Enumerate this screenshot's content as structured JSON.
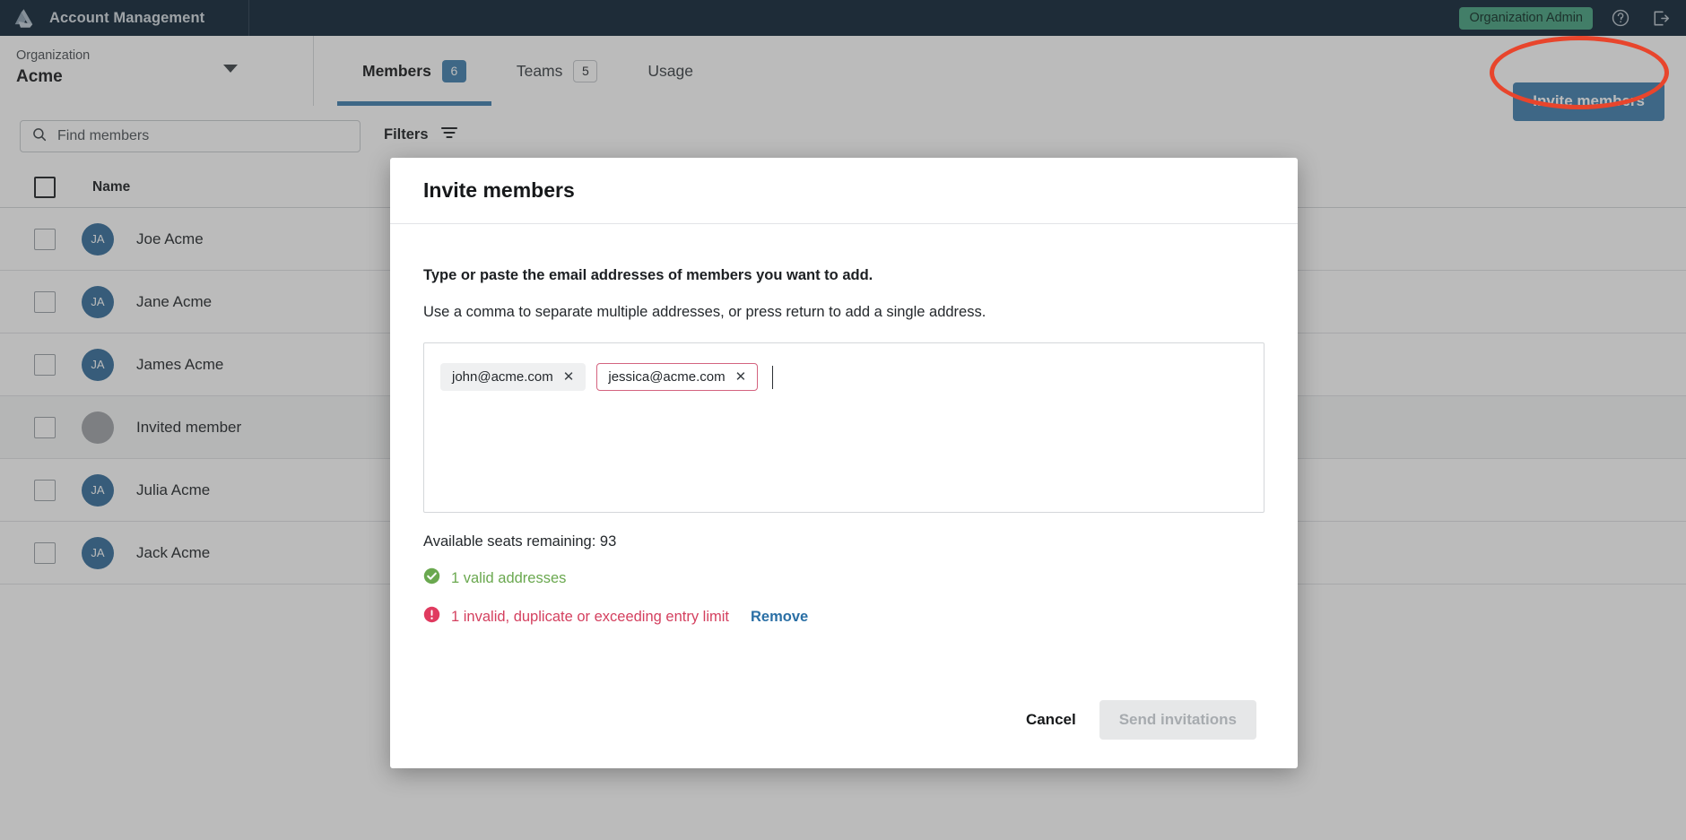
{
  "topbar": {
    "logo_icon": "drive-triangle-logo",
    "title": "Account Management",
    "role_badge": "Organization Admin",
    "help_icon": "help-circle-icon",
    "logout_icon": "logout-icon"
  },
  "subheader": {
    "org_label": "Organization",
    "org_name": "Acme",
    "caret_icon": "chevron-down-icon",
    "tabs": [
      {
        "label": "Members",
        "badge": "6",
        "active": true
      },
      {
        "label": "Teams",
        "badge": "5",
        "active": false
      },
      {
        "label": "Usage",
        "badge": "",
        "active": false
      }
    ],
    "invite_button": "Invite members"
  },
  "toolbar": {
    "search_icon": "search-icon",
    "search_placeholder": "Find members",
    "search_value": "",
    "filters_label": "Filters",
    "filters_icon": "filter-icon"
  },
  "table": {
    "select_all_checkbox": "",
    "columns": [
      "Name"
    ],
    "rows": [
      {
        "initials": "JA",
        "name": "Joe Acme",
        "invited": false
      },
      {
        "initials": "JA",
        "name": "Jane Acme",
        "invited": false
      },
      {
        "initials": "JA",
        "name": "James Acme",
        "invited": false
      },
      {
        "initials": "",
        "name": "Invited member",
        "invited": true
      },
      {
        "initials": "JA",
        "name": "Julia Acme",
        "invited": false
      },
      {
        "initials": "JA",
        "name": "Jack Acme",
        "invited": false
      }
    ]
  },
  "modal": {
    "title": "Invite members",
    "instruction_primary": "Type or paste the email addresses of members you want to add.",
    "instruction_secondary": "Use a comma to separate multiple addresses, or press return to add a single address.",
    "chips": [
      {
        "email": "john@acme.com",
        "state": "valid",
        "remove_icon": "close-icon"
      },
      {
        "email": "jessica@acme.com",
        "state": "invalid",
        "remove_icon": "close-icon"
      }
    ],
    "seats_text": "Available seats remaining: 93",
    "valid_icon": "check-circle-icon",
    "valid_text": "1 valid addresses",
    "invalid_icon": "error-circle-icon",
    "invalid_text": "1 invalid, duplicate or exceeding entry limit",
    "remove_link": "Remove",
    "cancel_button": "Cancel",
    "send_button": "Send invitations"
  },
  "annotation": {
    "shape": "ellipse-highlight",
    "color": "#e8452c",
    "target": "invite-members-button"
  },
  "colors": {
    "topbar_bg": "#0f2436",
    "accent_blue": "#3f7fae",
    "badge_green": "#46a180",
    "valid_green": "#6aa84f",
    "invalid_red": "#d4405f",
    "annotation_red": "#e8452c"
  }
}
